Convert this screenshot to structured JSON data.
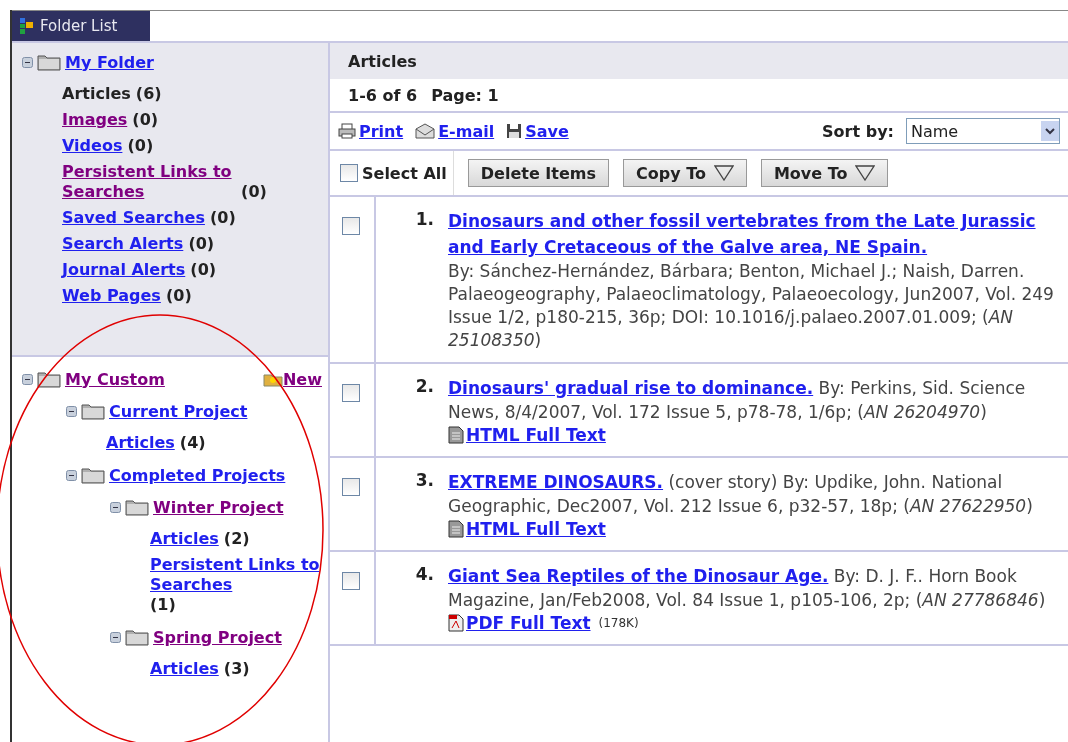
{
  "tab": {
    "label": "Folder List"
  },
  "my_folder": {
    "title": "My Folder",
    "expanded": true,
    "visited": false,
    "items": [
      {
        "label": "Articles",
        "count": "(6)",
        "link": false
      },
      {
        "label": "Images",
        "count": "(0)",
        "link": true,
        "visited": true
      },
      {
        "label": "Videos",
        "count": "(0)",
        "link": true,
        "visited": false
      },
      {
        "label": "Persistent Links to Searches",
        "count": "(0)",
        "link": true,
        "visited": true
      },
      {
        "label": "Saved Searches",
        "count": "(0)",
        "link": true,
        "visited": false
      },
      {
        "label": "Search Alerts",
        "count": "(0)",
        "link": true,
        "visited": false
      },
      {
        "label": "Journal Alerts",
        "count": "(0)",
        "link": true,
        "visited": false
      },
      {
        "label": "Web Pages",
        "count": "(0)",
        "link": true,
        "visited": false
      }
    ]
  },
  "my_custom": {
    "title": "My Custom",
    "expanded": true,
    "visited": true,
    "new_label": "New",
    "children": [
      {
        "title": "Current Project",
        "expanded": true,
        "visited": false,
        "items": [
          {
            "label": "Articles",
            "count": "(4)",
            "link": true,
            "visited": false
          }
        ]
      },
      {
        "title": "Completed Projects",
        "expanded": true,
        "visited": false,
        "children": [
          {
            "title": "Winter Project",
            "expanded": true,
            "visited": true,
            "items": [
              {
                "label": "Articles",
                "count": "(2)",
                "link": true,
                "visited": false
              },
              {
                "label": "Persistent Links to Searches",
                "count": "(1)",
                "link": true,
                "visited": false
              }
            ]
          },
          {
            "title": "Spring Project",
            "expanded": true,
            "visited": true,
            "items": [
              {
                "label": "Articles",
                "count": "(3)",
                "link": true,
                "visited": false
              }
            ]
          }
        ]
      }
    ]
  },
  "articles": {
    "title": "Articles",
    "range": "1-6 of 6",
    "page": "Page: 1",
    "actions": [
      {
        "kind": "print",
        "label": "Print"
      },
      {
        "kind": "email",
        "label": "E-mail"
      },
      {
        "kind": "save",
        "label": "Save"
      }
    ],
    "sort": {
      "label": "Sort by:",
      "value": "Name"
    },
    "select_all": {
      "label": "Select All",
      "checked": false
    },
    "buttons": [
      {
        "label": "Delete Items",
        "dropdown": false
      },
      {
        "label": "Copy To",
        "dropdown": true
      },
      {
        "label": "Move To",
        "dropdown": true
      }
    ],
    "results": [
      {
        "number": "1.",
        "title": "Dinosaurs and other fossil vertebrates from the Late Jurassic and Early Cretaceous of the Galve area, NE Spain.",
        "byline": "By: Sánchez-Hernández, Bárbara; Benton, Michael J.; Naish, Darren. Palaeogeography, Palaeoclimatology, Palaeoecology, Jun2007, Vol. 249 Issue 1/2, p180-215, 36p; DOI: 10.1016/j.palaeo.2007.01.009; (*AN 25108350*)",
        "checked": false
      },
      {
        "number": "2.",
        "title": "Dinosaurs' gradual rise to dominance.",
        "byline": "By: Perkins, Sid. Science News, 8/4/2007, Vol. 172 Issue 5, p78-78, 1/6p; (*AN 26204970*)",
        "checked": false,
        "fulltext": {
          "kind": "html",
          "label": "HTML Full Text"
        }
      },
      {
        "number": "3.",
        "title": "EXTREME DINOSAURS.",
        "byline": "(cover story) By: Updike, John. National Geographic, Dec2007, Vol. 212 Issue 6, p32-57, 18p; (*AN 27622950*)",
        "checked": false,
        "fulltext": {
          "kind": "html",
          "label": "HTML Full Text"
        }
      },
      {
        "number": "4.",
        "title": "Giant Sea Reptiles of the Dinosaur Age.",
        "byline": "By: D. J. F.. Horn Book Magazine, Jan/Feb2008, Vol. 84 Issue 1, p105-106, 2p; (*AN 27786846*)",
        "checked": false,
        "fulltext": {
          "kind": "pdf",
          "label": "PDF Full Text",
          "size": "(178K)"
        }
      }
    ]
  },
  "annotation": {
    "kind": "ellipse"
  }
}
